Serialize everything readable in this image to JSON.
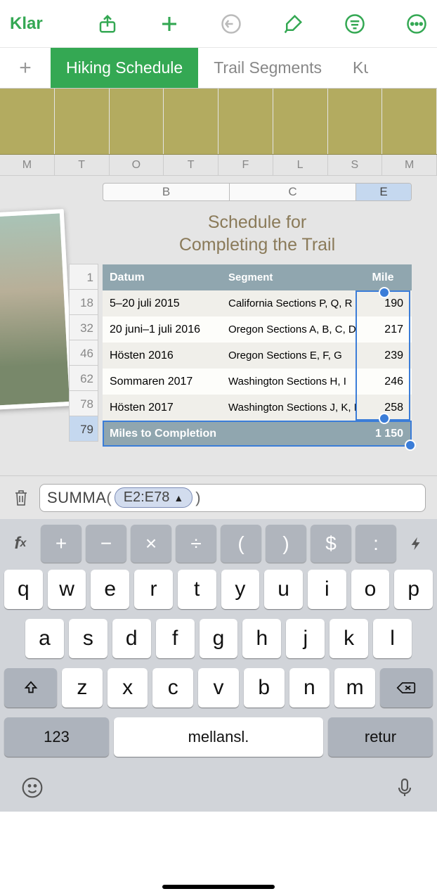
{
  "toolbar": {
    "done": "Klar"
  },
  "tabs": {
    "0": "Hiking Schedule",
    "1": "Trail Segments",
    "2": "Ku"
  },
  "week": {
    "0": "M",
    "1": "T",
    "2": "O",
    "3": "T",
    "4": "F",
    "5": "L",
    "6": "S",
    "7": "M"
  },
  "cols": {
    "B": "B",
    "C": "C",
    "E": "E"
  },
  "title": "Schedule for\nCompleting the Trail",
  "title_l1": "Schedule for",
  "title_l2": "Completing the Trail",
  "hdr": {
    "date": "Datum",
    "seg": "Segment",
    "mile": "Mile"
  },
  "rownums": {
    "0": "1",
    "1": "18",
    "2": "32",
    "3": "46",
    "4": "62",
    "5": "78",
    "6": "79"
  },
  "rows": {
    "0": {
      "date": "5–20 juli 2015",
      "seg": "California Sections P, Q, R",
      "mile": "190"
    },
    "1": {
      "date": "20 juni–1 juli 2016",
      "seg": "Oregon Sections A, B, C, D",
      "mile": "217"
    },
    "2": {
      "date": "Hösten 2016",
      "seg": "Oregon Sections E, F, G",
      "mile": "239"
    },
    "3": {
      "date": "Sommaren 2017",
      "seg": "Washington Sections H, I",
      "mile": "246"
    },
    "4": {
      "date": "Hösten 2017",
      "seg": "Washington Sections J, K, L",
      "mile": "258"
    }
  },
  "sum": {
    "label": "Miles to Completion",
    "val": "1 150"
  },
  "formula": {
    "fn": "SUMMA",
    "arg": "E2:E78"
  },
  "fx": {
    "plus": "+",
    "minus": "−",
    "mul": "×",
    "div": "÷",
    "lp": "(",
    "rp": ")",
    "dol": "$",
    "col": ":"
  },
  "keys": {
    "r1": {
      "0": "q",
      "1": "w",
      "2": "e",
      "3": "r",
      "4": "t",
      "5": "y",
      "6": "u",
      "7": "i",
      "8": "o",
      "9": "p"
    },
    "r2": {
      "0": "a",
      "1": "s",
      "2": "d",
      "3": "f",
      "4": "g",
      "5": "h",
      "6": "j",
      "7": "k",
      "8": "l"
    },
    "r3": {
      "0": "z",
      "1": "x",
      "2": "c",
      "3": "v",
      "4": "b",
      "5": "n",
      "6": "m"
    },
    "num": "123",
    "space": "mellansl.",
    "ret": "retur"
  }
}
